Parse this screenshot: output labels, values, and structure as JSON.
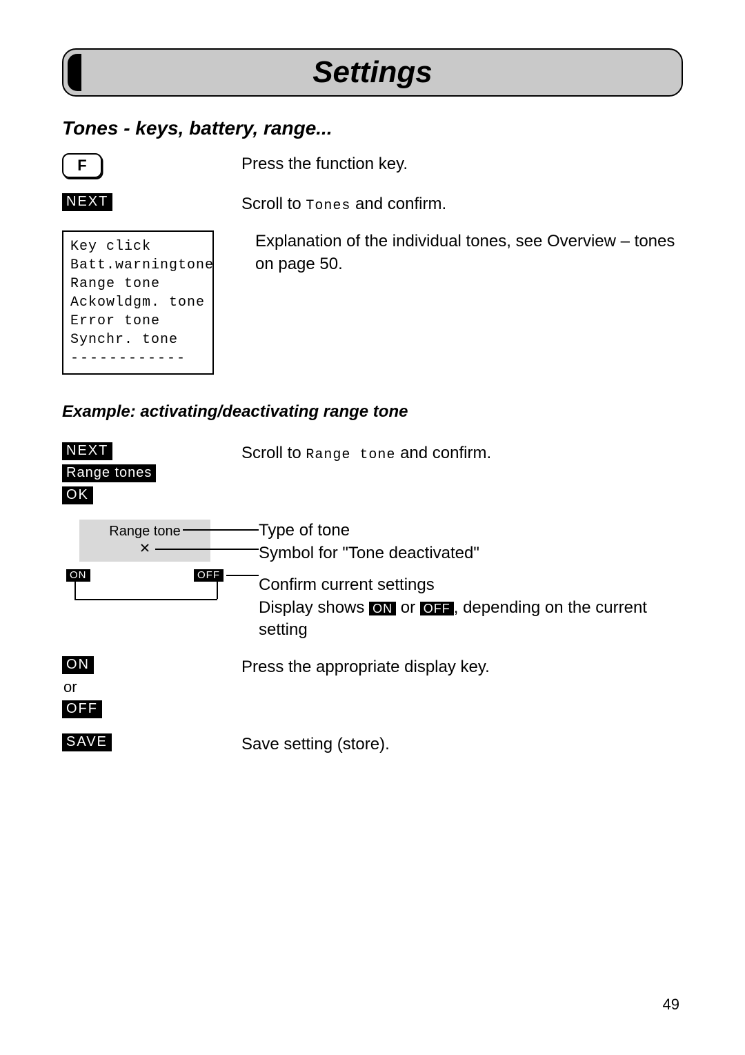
{
  "title": "Settings",
  "section_heading": "Tones - keys, battery, range...",
  "steps": {
    "fkey_label": "F",
    "fkey_text": "Press the function key.",
    "next_label": "NEXT",
    "tones_scroll_pre": "Scroll to ",
    "tones_lcd": "Tones",
    "tones_scroll_post": " and confirm.",
    "menu_items": {
      "i0": "Key click",
      "i1": "Batt.warningtone",
      "i2": "Range tone",
      "i3": "Ackowldgm. tone",
      "i4": "Error tone",
      "i5": "Synchr. tone",
      "dashes": "------------"
    },
    "explanation": "Explanation of the individual tones, see Overview – tones on page 50."
  },
  "example": {
    "heading": "Example: activating/deactivating range tone",
    "next_label": "NEXT",
    "range_tones_soft": "Range tones",
    "ok_label": "OK",
    "scroll_pre": "Scroll to ",
    "scroll_lcd": "Range tone",
    "scroll_post": " and confirm.",
    "diagram": {
      "row1": "Range tone",
      "symbol": "✕",
      "on": "ON",
      "off": "OFF",
      "right1": "Type of tone",
      "right2": "Symbol for \"Tone deactivated\"",
      "right3a": "Confirm current settings",
      "right3b_pre": "Display shows ",
      "right3b_on": "ON",
      "right3b_mid": " or ",
      "right3b_off": "OFF",
      "right3b_post": ", depending on the current setting"
    },
    "onoff": {
      "on": "ON",
      "or": "or",
      "off": "OFF",
      "text": "Press the appropriate display key."
    },
    "save": {
      "label": "SAVE",
      "text": "Save setting (store)."
    }
  },
  "page_number": "49"
}
